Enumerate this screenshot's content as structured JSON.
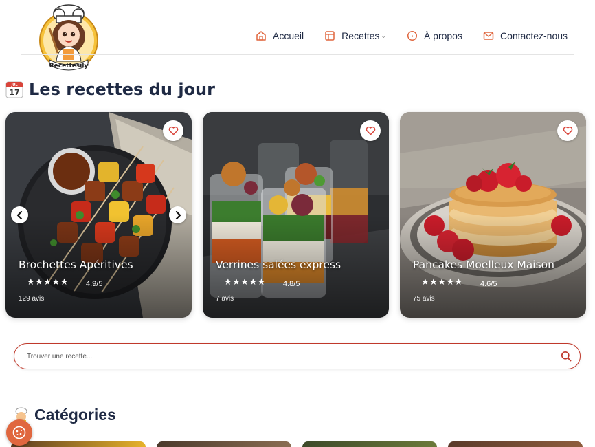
{
  "brand": {
    "logo_text": "Recettesily"
  },
  "nav": {
    "items": [
      {
        "label": "Accueil",
        "icon": "home-icon"
      },
      {
        "label": "Recettes",
        "icon": "recipes-icon",
        "has_dropdown": true
      },
      {
        "label": "À propos",
        "icon": "info-icon"
      },
      {
        "label": "Contactez-nous",
        "icon": "mail-icon"
      }
    ],
    "accent_color": "#e0673f"
  },
  "daily": {
    "title": "Les recettes du jour",
    "calendar_day": "17",
    "calendar_month": "JUL",
    "cards": [
      {
        "title": "Brochettes Apéritives",
        "stars": "★★★★★",
        "rating": "4.9/5",
        "reviews": "129 avis"
      },
      {
        "title": "Verrines salées express",
        "stars": "★★★★★",
        "rating": "4.8/5",
        "reviews": "7 avis"
      },
      {
        "title": "Pancakes Moelleux Maison",
        "stars": "★★★★★",
        "rating": "4.6/5",
        "reviews": "75 avis"
      }
    ]
  },
  "search": {
    "placeholder": "Trouver une recette...",
    "border_color": "#c0392b"
  },
  "categories": {
    "title": "Catégories"
  }
}
